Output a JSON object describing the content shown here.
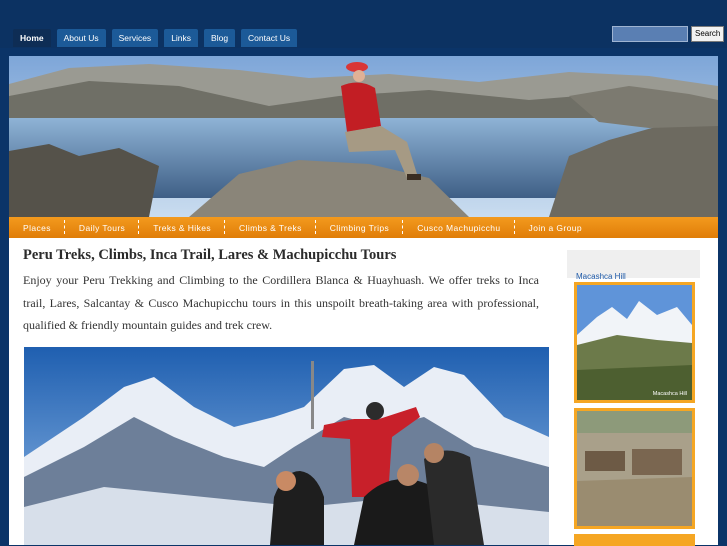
{
  "top_nav": {
    "items": [
      {
        "label": "Home",
        "active": true
      },
      {
        "label": "About Us"
      },
      {
        "label": "Services"
      },
      {
        "label": "Links"
      },
      {
        "label": "Blog"
      },
      {
        "label": "Contact Us"
      }
    ]
  },
  "search": {
    "placeholder": "",
    "button_label": "Search"
  },
  "sub_nav": {
    "items": [
      "Places",
      "Daily Tours",
      "Treks & Hikes",
      "Climbs & Treks",
      "Climbing Trips",
      "Cusco Machupicchu",
      "Join a Group"
    ]
  },
  "main": {
    "headline": "Peru Treks, Climbs, Inca Trail, Lares & Machupicchu Tours",
    "intro": "Enjoy your Peru Trekking and Climbing to the Cordillera Blanca & Huayhuash. We offer treks to Inca trail, Lares, Salcantay & Cusco Machupicchu tours in this unspoilt breath-taking area with professional, qualified & friendly mountain guides and trek crew."
  },
  "sidebar": {
    "title": "Macashca Hill",
    "thumb_caption": "Macashca Hill"
  },
  "colors": {
    "page_bg": "#0b3468",
    "tab_bg": "#1c5a98",
    "sub_nav_orange": "#ef8f14",
    "link_blue": "#1e5aa8"
  }
}
